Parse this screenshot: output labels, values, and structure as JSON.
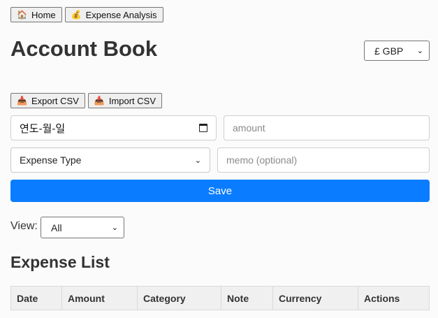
{
  "nav": {
    "home": {
      "icon": "house-icon",
      "glyph": "🏠",
      "label": "Home"
    },
    "analysis": {
      "icon": "money-bag-icon",
      "glyph": "💰",
      "label": "Expense Analysis"
    }
  },
  "page_title": "Account Book",
  "currency": {
    "selected": "£ GBP"
  },
  "io": {
    "export": {
      "icon": "inbox-tray-icon",
      "glyph": "📥",
      "label": "Export CSV"
    },
    "import": {
      "icon": "inbox-tray-icon",
      "glyph": "📥",
      "label": "Import CSV"
    }
  },
  "form": {
    "date_value": "연도-월-일",
    "amount_placeholder": "amount",
    "type_selected": "Expense Type",
    "memo_placeholder": "memo (optional)",
    "save_label": "Save"
  },
  "view": {
    "label": "View:",
    "selected": "All"
  },
  "list": {
    "title": "Expense List",
    "columns": [
      "Date",
      "Amount",
      "Category",
      "Note",
      "Currency",
      "Actions"
    ]
  },
  "colors": {
    "accent": "#0a7cff",
    "background": "#fbfbfb",
    "header_bg": "#f0f0f0"
  }
}
